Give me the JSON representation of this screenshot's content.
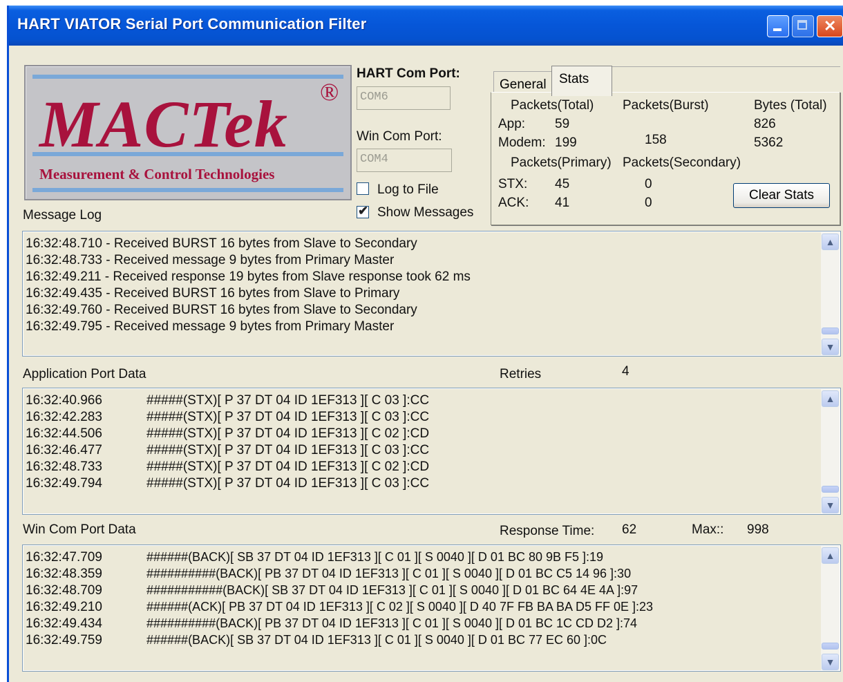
{
  "window": {
    "title": "HART VIATOR Serial Port Communication Filter",
    "colors": {
      "titlebar": "#0656d8",
      "face": "#ece9d8",
      "logo_text": "#a8123d"
    }
  },
  "logo": {
    "brand": "MACTek",
    "reg_mark": "®",
    "tagline": "Measurement & Control Technologies"
  },
  "ports": {
    "hart_label": "HART Com Port:",
    "hart_value": "COM6",
    "win_label": "Win Com Port:",
    "win_value": "COM4"
  },
  "options": {
    "log_to_file": {
      "label": "Log to File",
      "checked": false
    },
    "show_messages": {
      "label": "Show Messages",
      "checked": true
    }
  },
  "tabs": [
    {
      "label": "General",
      "active": false
    },
    {
      "label": "Stats",
      "active": true
    }
  ],
  "stats": {
    "hdr_packets_total": "Packets(Total)",
    "hdr_packets_burst": "Packets(Burst)",
    "hdr_bytes_total": "Bytes (Total)",
    "app_label": "App:",
    "app_total": "59",
    "app_bytes": "826",
    "modem_label": "Modem:",
    "modem_total": "199",
    "modem_burst": "158",
    "modem_bytes": "5362",
    "hdr_primary": "Packets(Primary)",
    "hdr_secondary": "Packets(Secondary)",
    "stx_label": "STX:",
    "stx_primary": "45",
    "stx_secondary": "0",
    "ack_label": "ACK:",
    "ack_primary": "41",
    "ack_secondary": "0",
    "clear_button": "Clear Stats"
  },
  "message_log": {
    "label": "Message Log",
    "lines": [
      "16:32:48.710 - Received BURST 16 bytes from Slave to Secondary",
      "16:32:48.733 - Received message 9 bytes from Primary Master",
      "16:32:49.211 - Received response 19 bytes from Slave response took 62 ms",
      "16:32:49.435 - Received BURST 16 bytes from Slave to Primary",
      "16:32:49.760 - Received BURST 16 bytes from Slave to Secondary",
      "16:32:49.795 - Received message 9 bytes from Primary Master"
    ]
  },
  "app_port": {
    "label": "Application Port Data",
    "retries_label": "Retries",
    "retries_value": "4",
    "rows": [
      {
        "time": "16:32:40.966",
        "data": "#####(STX)[ P 37 DT 04 ID  1EF313 ][ C 03 ]:CC"
      },
      {
        "time": "16:32:42.283",
        "data": "#####(STX)[ P 37 DT 04 ID  1EF313 ][ C 03 ]:CC"
      },
      {
        "time": "16:32:44.506",
        "data": "#####(STX)[ P 37 DT 04 ID  1EF313 ][ C 02 ]:CD"
      },
      {
        "time": "16:32:46.477",
        "data": "#####(STX)[ P 37 DT 04 ID  1EF313 ][ C 03 ]:CC"
      },
      {
        "time": "16:32:48.733",
        "data": "#####(STX)[ P 37 DT 04 ID  1EF313 ][ C 02 ]:CD"
      },
      {
        "time": "16:32:49.794",
        "data": "#####(STX)[ P 37 DT 04 ID  1EF313 ][ C 03 ]:CC"
      }
    ]
  },
  "win_port": {
    "label": "Win Com Port Data",
    "response_label": "Response Time:",
    "response_value": "62",
    "max_label": "Max::",
    "max_value": "998",
    "rows": [
      {
        "time": "16:32:47.709",
        "data": "######(BACK)[ SB 37 DT 04 ID  1EF313 ][ C 01 ][ S 0040 ][ D  01 BC 80 9B F5 ]:19"
      },
      {
        "time": "16:32:48.359",
        "data": "##########(BACK)[ PB 37 DT 04 ID  1EF313 ][ C 01 ][ S 0040 ][ D  01 BC C5 14 96 ]:30"
      },
      {
        "time": "16:32:48.709",
        "data": "###########(BACK)[ SB 37 DT 04 ID  1EF313 ][ C 01 ][ S 0040 ][ D  01 BC 64 4E 4A ]:97"
      },
      {
        "time": "16:32:49.210",
        "data": "######(ACK)[ PB 37 DT 04 ID  1EF313 ][ C 02 ][ S 0040 ][ D  40 7F FB BA BA D5 FF 0E ]:23"
      },
      {
        "time": "16:32:49.434",
        "data": "##########(BACK)[ PB 37 DT 04 ID  1EF313 ][ C 01 ][ S 0040 ][ D  01 BC 1C CD D2 ]:74"
      },
      {
        "time": "16:32:49.759",
        "data": "######(BACK)[ SB 37 DT 04 ID  1EF313 ][ C 01 ][ S 0040 ][ D  01 BC 77 EC 60 ]:0C"
      }
    ]
  }
}
